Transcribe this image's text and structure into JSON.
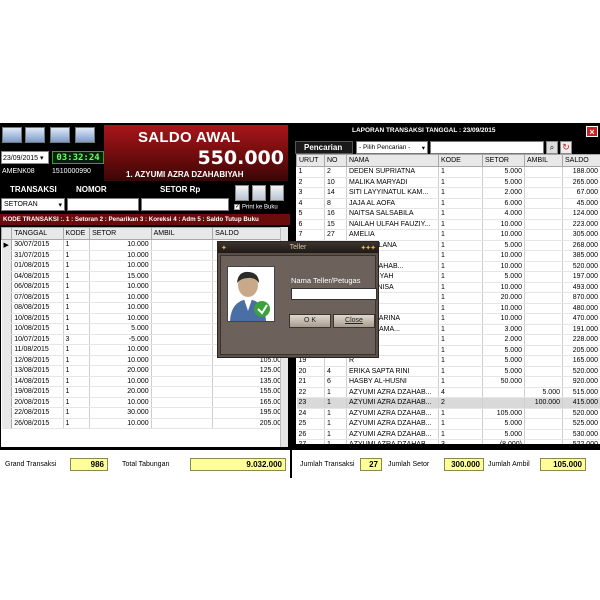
{
  "left": {
    "date": "23/09/2015",
    "clock": "03:32:24",
    "user_id": "AMENK08",
    "user_no": "1510000990",
    "saldo_title": "SALDO AWAL",
    "saldo_value": "550.000",
    "member": "1. AZYUMI AZRA DZAHABIYAH",
    "headers": {
      "transaksi": "TRANSAKSI",
      "nomor": "NOMOR",
      "setor": "SETOR Rp"
    },
    "trx_value": "SETORAN",
    "print_label": "Print ke Buku",
    "kode_legend": "KODE TRANSAKSI :. 1 : Setoran  2 : Penarikan  3 : Koreksi  4 : Adm  5 : Saldo Tutup Buku",
    "columns": [
      "TANGGAL",
      "KODE",
      "SETOR",
      "AMBIL",
      "SALDO"
    ],
    "rows": [
      [
        "30/07/2015",
        "1",
        "10.000",
        "",
        "10.000"
      ],
      [
        "31/07/2015",
        "1",
        "10.000",
        "",
        "20.000"
      ],
      [
        "01/08/2015",
        "1",
        "10.000",
        "",
        "30.000"
      ],
      [
        "04/08/2015",
        "1",
        "15.000",
        "",
        "45.000"
      ],
      [
        "06/08/2015",
        "1",
        "10.000",
        "",
        "55.000"
      ],
      [
        "07/08/2015",
        "1",
        "10.000",
        "",
        "65.000"
      ],
      [
        "08/08/2015",
        "1",
        "10.000",
        "",
        "75.000"
      ],
      [
        "10/08/2015",
        "1",
        "10.000",
        "",
        "85.000"
      ],
      [
        "10/08/2015",
        "1",
        "5.000",
        "",
        "90.000"
      ],
      [
        "10/07/2015",
        "3",
        "-5.000",
        "",
        "85.000"
      ],
      [
        "11/08/2015",
        "1",
        "10.000",
        "",
        "95.000"
      ],
      [
        "12/08/2015",
        "1",
        "10.000",
        "",
        "105.000"
      ],
      [
        "13/08/2015",
        "1",
        "20.000",
        "",
        "125.000"
      ],
      [
        "14/08/2015",
        "1",
        "10.000",
        "",
        "135.000"
      ],
      [
        "19/08/2015",
        "1",
        "20.000",
        "",
        "155.000"
      ],
      [
        "20/08/2015",
        "1",
        "10.000",
        "",
        "165.000"
      ],
      [
        "22/08/2015",
        "1",
        "30.000",
        "",
        "195.000"
      ],
      [
        "26/08/2015",
        "1",
        "10.000",
        "",
        "205.000"
      ]
    ],
    "footer": {
      "grand_label": "Grand Transaksi",
      "grand_value": "986",
      "total_label": "Total Tabungan",
      "total_value": "9.032.000"
    }
  },
  "right": {
    "title": "LAPORAN TRANSAKSI TANGGAL : 23/09/2015",
    "search_label": "Pencarian",
    "search_select": "- Pilih Pencarian -",
    "columns": [
      "URUT",
      "NO",
      "NAMA",
      "KODE",
      "SETOR",
      "AMBIL",
      "SALDO"
    ],
    "rows": [
      [
        "1",
        "2",
        "DEDEN SUPRIATNA",
        "1",
        "5.000",
        "",
        "188.000"
      ],
      [
        "2",
        "10",
        "MALIKA MARYADI",
        "1",
        "5.000",
        "",
        "265.000"
      ],
      [
        "3",
        "14",
        "SITI LAYYINATUL KAM...",
        "1",
        "2.000",
        "",
        "67.000"
      ],
      [
        "4",
        "8",
        "JAJA AL AOFA",
        "1",
        "6.000",
        "",
        "45.000"
      ],
      [
        "5",
        "16",
        "NAITSA SALSABILA",
        "1",
        "4.000",
        "",
        "124.000"
      ],
      [
        "6",
        "15",
        "NAILAH ULFAH FAUZIY...",
        "1",
        "10.000",
        "",
        "223.000"
      ],
      [
        "7",
        "27",
        "AMELIA",
        "1",
        "10.000",
        "",
        "305.000"
      ],
      [
        "8",
        "3",
        "EGI MAULANA",
        "1",
        "5.000",
        "",
        "268.000"
      ],
      [
        "9",
        "",
        "",
        "1",
        "10.000",
        "",
        "385.000"
      ],
      [
        "10",
        "",
        "AZRA DZAHAB...",
        "1",
        "10.000",
        "",
        "520.000"
      ],
      [
        "11",
        "",
        "RDIYANSYAH",
        "1",
        "5.000",
        "",
        "197.000"
      ],
      [
        "12",
        "",
        "ROSTIN NISA",
        "1",
        "10.000",
        "",
        "493.000"
      ],
      [
        "13",
        "",
        "AULANA",
        "1",
        "20.000",
        "",
        "870.000"
      ],
      [
        "14",
        "",
        "MADHAN",
        "1",
        "10.000",
        "",
        "480.000"
      ],
      [
        "15",
        "",
        "UR SYAPARINA",
        "1",
        "10.000",
        "",
        "470.000"
      ],
      [
        "16",
        "",
        "ULANA RAMA...",
        "1",
        "3.000",
        "",
        "191.000"
      ],
      [
        "17",
        "",
        "IDAYAT",
        "1",
        "2.000",
        "",
        "228.000"
      ],
      [
        "18",
        "",
        "AYAH",
        "1",
        "5.000",
        "",
        "205.000"
      ],
      [
        "19",
        "",
        "R",
        "1",
        "5.000",
        "",
        "165.000"
      ],
      [
        "20",
        "4",
        "ERIKA SAPTA RINI",
        "1",
        "5.000",
        "",
        "520.000"
      ],
      [
        "21",
        "6",
        "HASBY AL-HUSNI",
        "1",
        "50.000",
        "",
        "920.000"
      ],
      [
        "22",
        "1",
        "AZYUMI AZRA DZAHAB...",
        "4",
        "",
        "5.000",
        "515.000"
      ],
      [
        "23",
        "1",
        "AZYUMI AZRA DZAHAB...",
        "2",
        "",
        "100.000",
        "415.000"
      ],
      [
        "24",
        "1",
        "AZYUMI AZRA DZAHAB...",
        "1",
        "105.000",
        "",
        "520.000"
      ],
      [
        "25",
        "1",
        "AZYUMI AZRA DZAHAB...",
        "1",
        "5.000",
        "",
        "525.000"
      ],
      [
        "26",
        "1",
        "AZYUMI AZRA DZAHAB...",
        "1",
        "5.000",
        "",
        "530.000"
      ],
      [
        "27",
        "1",
        "AZYUMI AZRA DZAHAB...",
        "3",
        "(8.000)",
        "",
        "522.000"
      ]
    ],
    "footer": {
      "jt_label": "Jumlah Transaksi",
      "jt_value": "27",
      "js_label": "Jumlah Setor",
      "js_value": "300.000",
      "ja_label": "Jumlah Ambil",
      "ja_value": "105.000"
    }
  },
  "dialog": {
    "title": "Teller",
    "label": "Nama Teller/Petugas",
    "ok": "O K",
    "close": "Close"
  },
  "colors": {
    "accent_red": "#8b1014",
    "highlight": "#ffff9a",
    "row_select": "#d9d9d9"
  }
}
